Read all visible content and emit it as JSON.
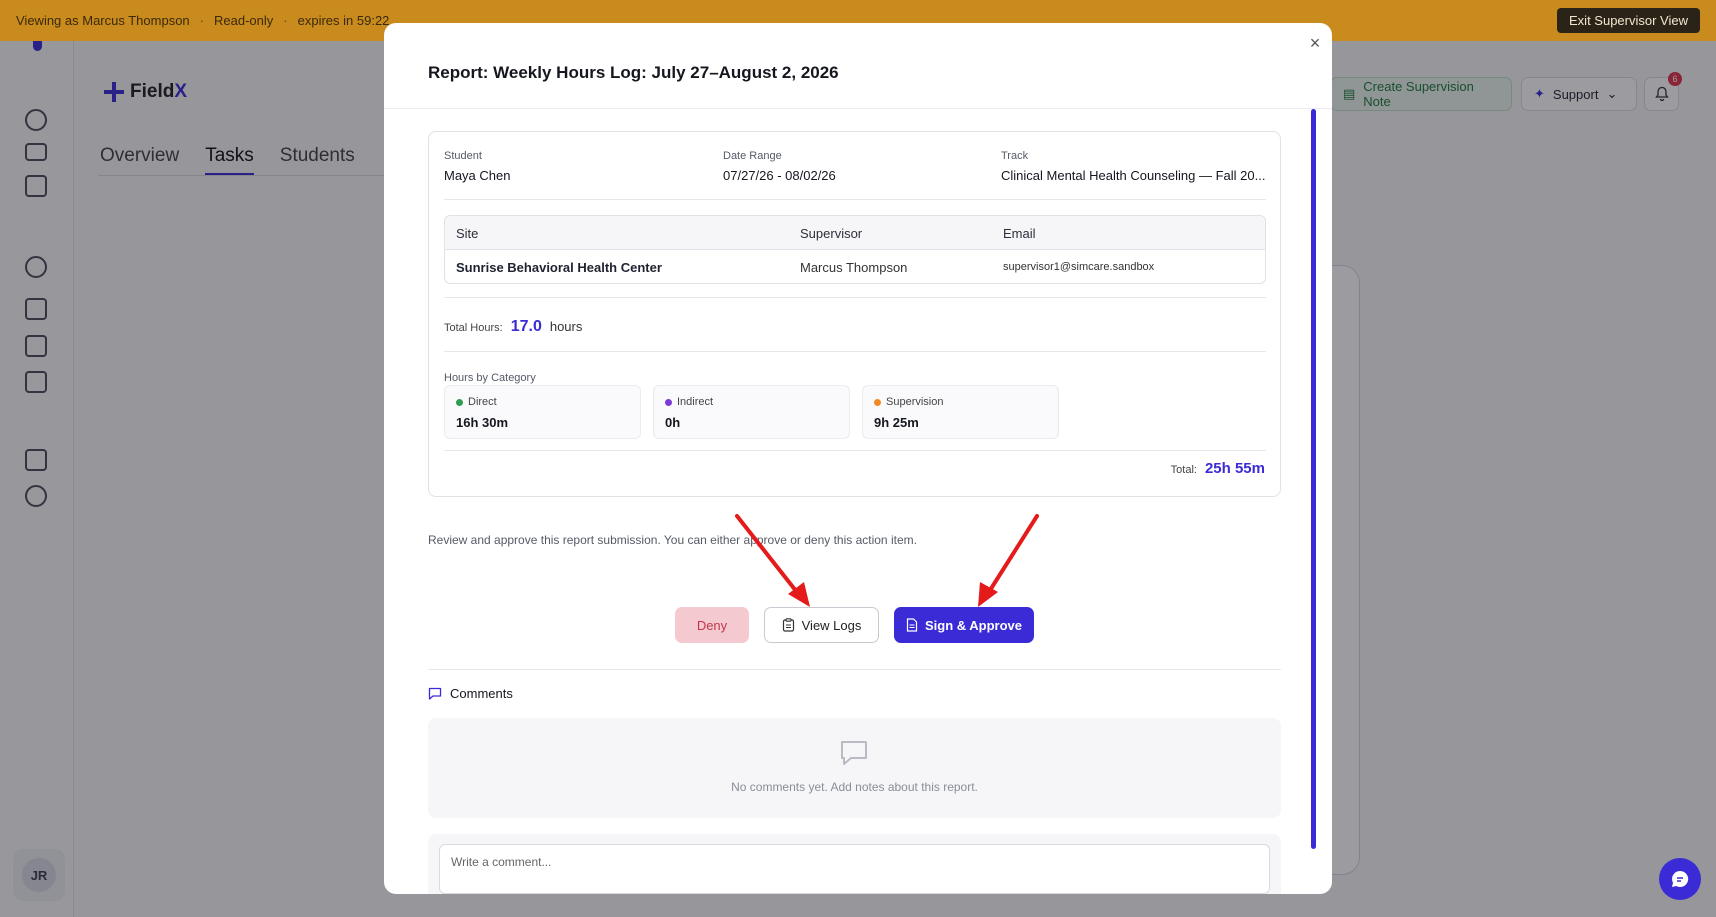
{
  "banner": {
    "viewing_as": "Viewing as Marcus Thompson",
    "separator": "·",
    "mode": "Read-only",
    "expires": "expires in 59:22",
    "exit_label": "Exit Supervisor View"
  },
  "brand": {
    "prefix": "Field",
    "suffix": "X"
  },
  "tabs": [
    {
      "label": "Overview"
    },
    {
      "label": "Tasks"
    },
    {
      "label": "Students"
    }
  ],
  "header": {
    "note_label": "Create Supervision Note",
    "support_label": "Support",
    "notification_count": "6"
  },
  "sidebar": {
    "user_initials": "JR"
  },
  "modal": {
    "title": "Report: Weekly Hours Log: July 27–August 2, 2026",
    "close_symbol": "×",
    "meta": {
      "student_label": "Student",
      "student_value": "Maya Chen",
      "date_label": "Date Range",
      "date_value": "07/27/26 - 08/02/26",
      "track_label": "Track",
      "track_value": "Clinical Mental Health Counseling — Fall 20..."
    },
    "site_table": {
      "headers": [
        "Site",
        "Supervisor",
        "Email"
      ],
      "row": [
        "Sunrise Behavioral Health Center",
        "Marcus Thompson",
        "supervisor1@simcare.sandbox"
      ]
    },
    "total_hours": {
      "label": "Total Hours:",
      "value": "17.0",
      "unit": "hours"
    },
    "categories_label": "Hours by Category",
    "categories": [
      {
        "name": "Direct",
        "value": "16h 30m",
        "color": "#2e9e4f"
      },
      {
        "name": "Indirect",
        "value": "0h",
        "color": "#7a3bd6"
      },
      {
        "name": "Supervision",
        "value": "9h 25m",
        "color": "#f08a24"
      }
    ],
    "grand_total": {
      "label": "Total:",
      "value": "25h 55m"
    },
    "review_text": "Review and approve this report submission. You can either approve or deny this action item.",
    "buttons": {
      "deny": "Deny",
      "view_logs": "View Logs",
      "approve": "Sign & Approve"
    },
    "comments": {
      "title": "Comments",
      "empty_message": "No comments yet. Add notes about this report.",
      "placeholder": "Write a comment..."
    }
  },
  "colors": {
    "accent": "#3a2bd6",
    "banner": "#c98a1e",
    "deny_bg": "#f4c9cf",
    "annotation_arrow": "#e51b1b"
  }
}
